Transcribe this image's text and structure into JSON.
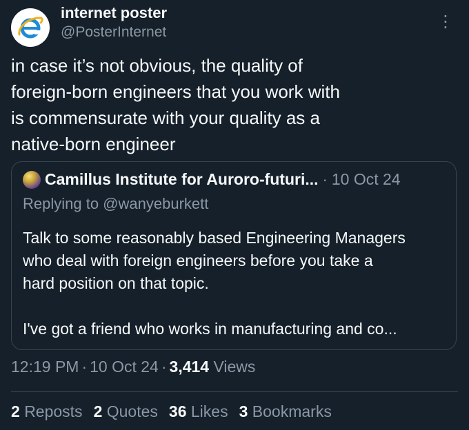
{
  "author": {
    "display_name": "internet poster",
    "handle": "@PosterInternet",
    "avatar_icon": "internet-explorer-icon"
  },
  "tweet": {
    "lines": [
      "in case it’s not obvious, the quality of",
      "foreign-born engineers that you work with",
      "is commensurate with your quality as a",
      "native-born engineer"
    ]
  },
  "quote": {
    "name": "Camillus Institute for Auroro-futuri...",
    "date": "10 Oct 24",
    "replying_to": "Replying to @wanyeburkett",
    "body_p1_lines": [
      "Talk to some reasonably based Engineering Managers",
      "who deal with foreign engineers before you take a",
      "hard position on that topic."
    ],
    "body_p2": "I've got a friend who works in manufacturing and co..."
  },
  "meta": {
    "time": "12:19 PM",
    "date": "10 Oct 24",
    "views_count": "3,414",
    "views_label": "Views"
  },
  "stats": {
    "reposts": {
      "count": "2",
      "label": "Reposts"
    },
    "quotes": {
      "count": "2",
      "label": "Quotes"
    },
    "likes": {
      "count": "36",
      "label": "Likes"
    },
    "bookmarks": {
      "count": "3",
      "label": "Bookmarks"
    }
  },
  "colors": {
    "background": "#15202b",
    "text": "#f7f9f9",
    "muted": "#8b98a5",
    "border": "#38444d",
    "ie_blue": "#1e8bd6"
  }
}
